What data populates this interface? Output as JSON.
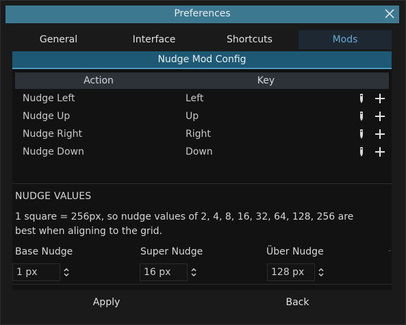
{
  "window": {
    "title": "Preferences",
    "close_icon": "close-icon"
  },
  "tabs": [
    {
      "label": "General",
      "active": false
    },
    {
      "label": "Interface",
      "active": false
    },
    {
      "label": "Shortcuts",
      "active": false
    },
    {
      "label": "Mods",
      "active": true
    }
  ],
  "nudge_config": {
    "header": "Nudge Mod Config",
    "columns": {
      "action": "Action",
      "key": "Key"
    },
    "rows": [
      {
        "action": "Nudge Left",
        "key": "Left",
        "edit_icon": "pencil-icon",
        "add_icon": "plus-icon"
      },
      {
        "action": "Nudge Up",
        "key": "Up",
        "edit_icon": "pencil-icon",
        "add_icon": "plus-icon"
      },
      {
        "action": "Nudge Right",
        "key": "Right",
        "edit_icon": "pencil-icon",
        "add_icon": "plus-icon"
      },
      {
        "action": "Nudge Down",
        "key": "Down",
        "edit_icon": "pencil-icon",
        "add_icon": "plus-icon"
      }
    ]
  },
  "nudge_values": {
    "title": "NUDGE VALUES",
    "description": "1 square = 256px, so nudge values of 2, 4, 8, 16, 32, 64, 128, 256 are best when aligning to the grid.",
    "fields": [
      {
        "label": "Base Nudge",
        "value": "1 px"
      },
      {
        "label": "Super Nudge",
        "value": "16 px"
      },
      {
        "label": "Über Nudge",
        "value": "128 px"
      }
    ]
  },
  "footer": {
    "apply_label": "Apply",
    "back_label": "Back"
  },
  "colors": {
    "titlebar": "#3d7891",
    "section_header": "#1d5975",
    "active_tab_text": "#6aa7d4",
    "background": "#1a1a1a"
  }
}
